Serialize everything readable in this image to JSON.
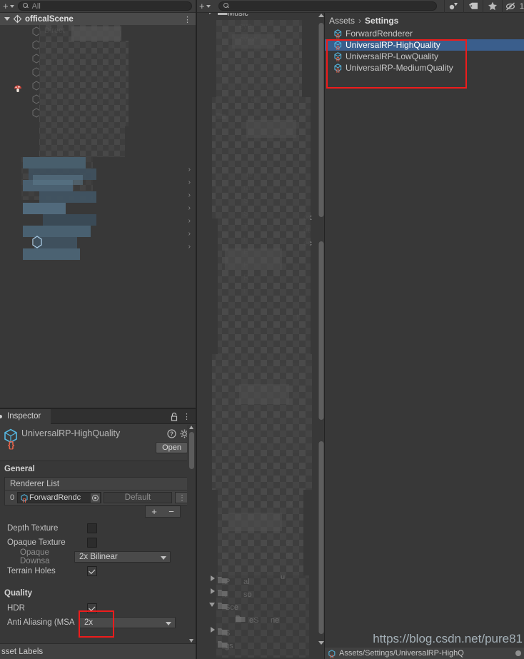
{
  "hierarchy": {
    "toolbar": {
      "add_label": "+",
      "search_placeholder": "All"
    },
    "scene_name": "officalScene",
    "menu_icon": "⋮",
    "blurred_note": ""
  },
  "project": {
    "toolbar": {
      "add_label": "+",
      "search_placeholder": "",
      "favorite_count": "1"
    },
    "breadcrumb": {
      "root": "Assets",
      "separator": "›",
      "current": "Settings"
    },
    "assets": [
      {
        "name": "ForwardRenderer",
        "selected": false
      },
      {
        "name": "UniversalRP-HighQuality",
        "selected": true
      },
      {
        "name": "UniversalRP-LowQuality",
        "selected": false
      },
      {
        "name": "UniversalRP-MediumQuality",
        "selected": false
      }
    ],
    "status_path": "Assets/Settings/UniversalRP-HighQ"
  },
  "inspector": {
    "tab_label": "Inspector",
    "asset_name": "UniversalRP-HighQuality",
    "open_button": "Open",
    "sections": {
      "general": {
        "title": "General",
        "renderer_list_header": "Renderer List",
        "renderer_row": {
          "index": "0",
          "object_value": "ForwardRendc",
          "default_label": "Default",
          "menu_icon": "⋮"
        },
        "add_label": "+",
        "remove_label": "−",
        "properties": [
          {
            "label": "Depth Texture",
            "type": "checkbox",
            "value": false,
            "dim": false
          },
          {
            "label": "Opaque Texture",
            "type": "checkbox",
            "value": false,
            "dim": false
          },
          {
            "label": "Opaque Downsa",
            "type": "dropdown",
            "value": "2x Bilinear",
            "dim": true
          },
          {
            "label": "Terrain Holes",
            "type": "checkbox",
            "value": true,
            "dim": false
          }
        ]
      },
      "quality": {
        "title": "Quality",
        "properties": [
          {
            "label": "HDR",
            "type": "checkbox",
            "value": true,
            "dim": false,
            "highlighted": true
          },
          {
            "label": "Anti Aliasing (MSA",
            "type": "dropdown",
            "value": "2x",
            "dim": false
          }
        ]
      }
    },
    "asset_labels": "sset Labels"
  },
  "annotations": {
    "watermark": "https://blog.csdn.net/pure81",
    "highlight_color": "#ee1c1c",
    "selection_color": "#3a5e8c"
  }
}
